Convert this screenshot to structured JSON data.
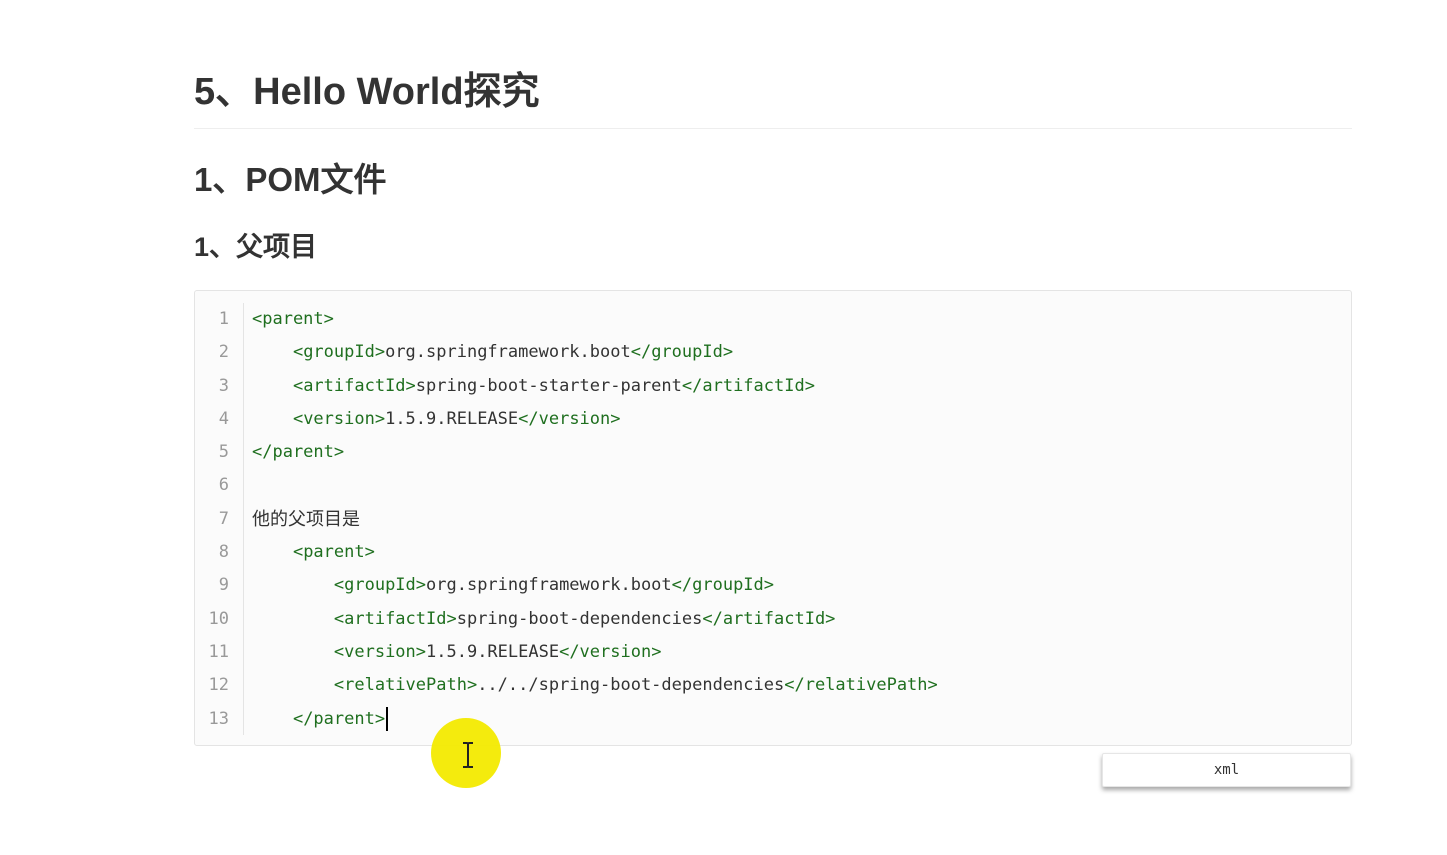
{
  "document": {
    "title": "5、Hello World探究",
    "section": "1、POM文件",
    "subsection": "1、父项目"
  },
  "code_block": {
    "language": "xml",
    "line_numbers": [
      "1",
      "2",
      "3",
      "4",
      "5",
      "6",
      "7",
      "8",
      "9",
      "10",
      "11",
      "12",
      "13"
    ],
    "lines": [
      {
        "indent": "",
        "open": "<parent>",
        "text": "",
        "close": ""
      },
      {
        "indent": "    ",
        "open": "<groupId>",
        "text": "org.springframework.boot",
        "close": "</groupId>"
      },
      {
        "indent": "    ",
        "open": "<artifactId>",
        "text": "spring-boot-starter-parent",
        "close": "</artifactId>"
      },
      {
        "indent": "    ",
        "open": "<version>",
        "text": "1.5.9.RELEASE",
        "close": "</version>"
      },
      {
        "indent": "",
        "open": "</parent>",
        "text": "",
        "close": ""
      },
      {
        "indent": "",
        "open": "",
        "text": "",
        "close": ""
      },
      {
        "indent": "",
        "open": "",
        "text": "他的父项目是",
        "close": ""
      },
      {
        "indent": "    ",
        "open": "<parent>",
        "text": "",
        "close": ""
      },
      {
        "indent": "        ",
        "open": "<groupId>",
        "text": "org.springframework.boot",
        "close": "</groupId>"
      },
      {
        "indent": "        ",
        "open": "<artifactId>",
        "text": "spring-boot-dependencies",
        "close": "</artifactId>"
      },
      {
        "indent": "        ",
        "open": "<version>",
        "text": "1.5.9.RELEASE",
        "close": "</version>"
      },
      {
        "indent": "        ",
        "open": "<relativePath>",
        "text": "../../spring-boot-dependencies",
        "close": "</relativePath>"
      },
      {
        "indent": "    ",
        "open": "</parent>",
        "text": "",
        "close": ""
      }
    ]
  },
  "colors": {
    "tag": "#1f6f1f",
    "text": "#333333",
    "line_number": "#999999",
    "cursor_highlight": "#f3ea00"
  },
  "icons": {
    "cursor": "text-cursor-ibeam-icon"
  }
}
